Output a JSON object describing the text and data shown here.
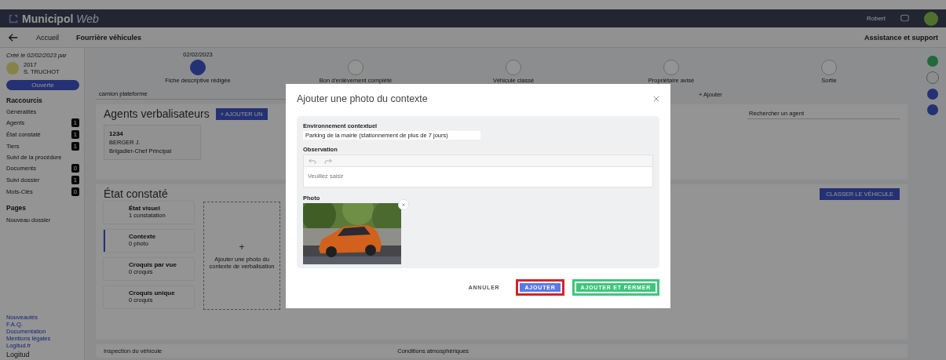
{
  "header": {
    "brand": "Municipol",
    "brand_suffix": "Web",
    "user": "Robert"
  },
  "breadcrumb": {
    "home": "Accueil",
    "current": "Fourrière véhicules",
    "support": "Assistance et support"
  },
  "sidebar": {
    "created": "Créé le 02/02/2023 par",
    "number": "2017",
    "author": "S. TRUCHOT",
    "status": "Ouverte",
    "shortcuts_title": "Raccourcis",
    "items": [
      {
        "label": "Généralités"
      },
      {
        "label": "Agents",
        "count": "1"
      },
      {
        "label": "État constaté",
        "count": "1"
      },
      {
        "label": "Tiers",
        "count": "1"
      },
      {
        "label": "Suivi de la procédure"
      },
      {
        "label": "Documents",
        "count": "0"
      },
      {
        "label": "Suivi dossier",
        "count": "1"
      },
      {
        "label": "Mots-Clés",
        "count": "0"
      }
    ],
    "pages_title": "Pages",
    "new_folder": "Nouveau dossier",
    "links": [
      "Nouveautés",
      "F.A.Q.",
      "Documentation",
      "Mentions légales",
      "Logitud.fr"
    ],
    "footer_logo": "Logitud"
  },
  "steps": [
    {
      "date": "02/02/2023",
      "label": "Fiche descriptive rédigée",
      "done": true
    },
    {
      "label": "Bon d'enlèvement complété",
      "done": false
    },
    {
      "label": "Véhicule classé",
      "done": false
    },
    {
      "label": "Propriétaire avisé",
      "done": false
    },
    {
      "label": "Sortie",
      "done": false
    }
  ],
  "vehicle_field": "camion plateforme",
  "add_link": "+ Ajouter",
  "agents": {
    "title": "Agents verbalisateurs",
    "add_button": "+ AJOUTER UN",
    "search_placeholder": "Rechercher un agent",
    "cards": [
      {
        "number": "1234",
        "name": "BERGER J.",
        "rank": "Brigadier-Chef Principal"
      }
    ]
  },
  "state": {
    "title": "État constaté",
    "classify_button": "CLASSER LE VÉHICULE",
    "tiles": [
      {
        "title": "État visuel",
        "count": "1 constatation",
        "selected": false
      },
      {
        "title": "Contexte",
        "count": "0 photo",
        "selected": true
      },
      {
        "title": "Croquis par vue",
        "count": "0 croquis",
        "selected": false
      },
      {
        "title": "Croquis unique",
        "count": "0 croquis",
        "selected": false
      }
    ],
    "dropzone_plus": "+",
    "dropzone_text": "Ajouter une photo du contexte de verbalisation"
  },
  "bottom_sections": [
    "Inspection du véhicule",
    "Conditions atmosphériques"
  ],
  "modal": {
    "title": "Ajouter une photo du contexte",
    "environment_label": "Environnement contextuel",
    "environment_value": "Parking de la mairie (stationnement de plus de 7 jours)",
    "observation_label": "Observation",
    "observation_placeholder": "Veuillez saisir",
    "photo_label": "Photo",
    "buttons": [
      {
        "kind": "text",
        "label": "ANNULER",
        "highlighted": false
      },
      {
        "kind": "primary",
        "label": "AJOUTER",
        "highlighted": true
      },
      {
        "kind": "success",
        "label": "AJOUTER ET FERMER",
        "highlighted": false
      }
    ]
  }
}
